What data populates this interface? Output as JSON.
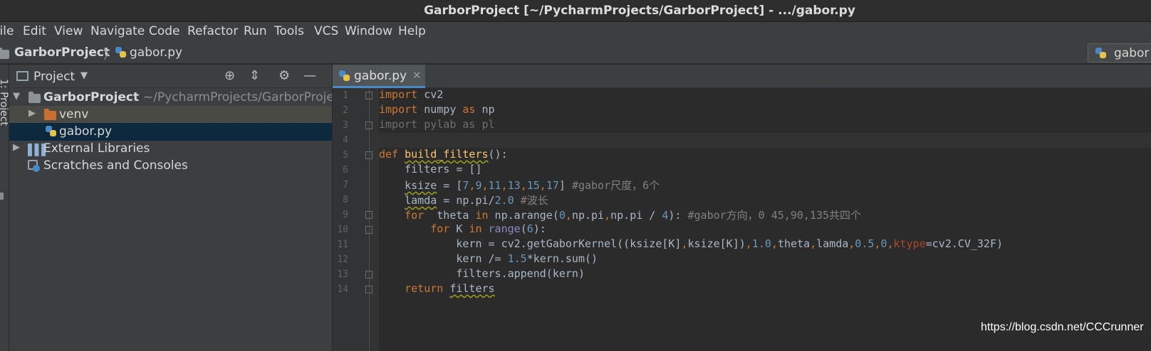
{
  "window": {
    "title": "GarborProject [~/PycharmProjects/GarborProject] - .../gabor.py"
  },
  "menu": [
    "File",
    "Edit",
    "View",
    "Navigate",
    "Code",
    "Refactor",
    "Run",
    "Tools",
    "VCS",
    "Window",
    "Help"
  ],
  "breadcrumb": {
    "project": "GarborProject",
    "file": "gabor.py"
  },
  "run_config": {
    "label": "gabor"
  },
  "tool_strip": {
    "label": "1: Project"
  },
  "project_panel": {
    "title": "Project",
    "tree": [
      {
        "label": "GarborProject",
        "path": "~/PycharmProjects/GarborProject"
      },
      {
        "label": "venv"
      },
      {
        "label": "gabor.py"
      },
      {
        "label": "External Libraries"
      },
      {
        "label": "Scratches and Consoles"
      }
    ]
  },
  "editor": {
    "tab": {
      "label": "gabor.py"
    },
    "line_numbers": [
      "1",
      "2",
      "3",
      "4",
      "5",
      "6",
      "7",
      "8",
      "9",
      "10",
      "11",
      "12",
      "13",
      "14"
    ]
  },
  "code_lines": [
    {
      "tokens": [
        {
          "c": "kw",
          "t": "import"
        },
        {
          "c": "",
          "t": " cv2"
        }
      ]
    },
    {
      "tokens": [
        {
          "c": "kw",
          "t": "import"
        },
        {
          "c": "",
          "t": " numpy "
        },
        {
          "c": "kw",
          "t": "as"
        },
        {
          "c": "",
          "t": " np"
        }
      ]
    },
    {
      "tokens": [
        {
          "c": "dim",
          "t": "import pylab as pl"
        }
      ]
    },
    {
      "tokens": []
    },
    {
      "tokens": [
        {
          "c": "kw",
          "t": "def "
        },
        {
          "c": "fn wavy",
          "t": "build_filters"
        },
        {
          "c": "",
          "t": "():"
        }
      ]
    },
    {
      "tokens": [
        {
          "c": "",
          "t": "    filters = []"
        }
      ]
    },
    {
      "tokens": [
        {
          "c": "",
          "t": "    "
        },
        {
          "c": "wavy",
          "t": "ksize"
        },
        {
          "c": "",
          "t": " = ["
        },
        {
          "c": "num",
          "t": "7"
        },
        {
          "c": "kw",
          "t": ","
        },
        {
          "c": "num",
          "t": "9"
        },
        {
          "c": "kw",
          "t": ","
        },
        {
          "c": "num",
          "t": "11"
        },
        {
          "c": "kw",
          "t": ","
        },
        {
          "c": "num",
          "t": "13"
        },
        {
          "c": "kw",
          "t": ","
        },
        {
          "c": "num",
          "t": "15"
        },
        {
          "c": "kw",
          "t": ","
        },
        {
          "c": "num",
          "t": "17"
        },
        {
          "c": "",
          "t": "] "
        },
        {
          "c": "cm",
          "t": "#gabor尺度，6个"
        }
      ]
    },
    {
      "tokens": [
        {
          "c": "",
          "t": "    "
        },
        {
          "c": "wavy",
          "t": "lamda"
        },
        {
          "c": "",
          "t": " = np.pi/"
        },
        {
          "c": "num",
          "t": "2.0"
        },
        {
          "c": "",
          "t": " "
        },
        {
          "c": "cm",
          "t": "#波长"
        }
      ]
    },
    {
      "tokens": [
        {
          "c": "",
          "t": "    "
        },
        {
          "c": "kw",
          "t": "for"
        },
        {
          "c": "",
          "t": "  theta "
        },
        {
          "c": "kw",
          "t": "in"
        },
        {
          "c": "",
          "t": " np.arange("
        },
        {
          "c": "num",
          "t": "0"
        },
        {
          "c": "kw",
          "t": ","
        },
        {
          "c": "",
          "t": "np.pi"
        },
        {
          "c": "kw",
          "t": ","
        },
        {
          "c": "",
          "t": "np.pi / "
        },
        {
          "c": "num",
          "t": "4"
        },
        {
          "c": "",
          "t": "): "
        },
        {
          "c": "cm",
          "t": "#gabor方向，0 45,90,135共四个"
        }
      ]
    },
    {
      "tokens": [
        {
          "c": "",
          "t": "        "
        },
        {
          "c": "kw",
          "t": "for"
        },
        {
          "c": "",
          "t": " K "
        },
        {
          "c": "kw",
          "t": "in"
        },
        {
          "c": "",
          "t": " "
        },
        {
          "c": "bi",
          "t": "range"
        },
        {
          "c": "",
          "t": "("
        },
        {
          "c": "num",
          "t": "6"
        },
        {
          "c": "",
          "t": "):"
        }
      ]
    },
    {
      "tokens": [
        {
          "c": "",
          "t": "            kern = cv2.getGaborKernel((ksize[K]"
        },
        {
          "c": "kw",
          "t": ","
        },
        {
          "c": "",
          "t": "ksize[K])"
        },
        {
          "c": "kw",
          "t": ","
        },
        {
          "c": "num",
          "t": "1.0"
        },
        {
          "c": "kw",
          "t": ","
        },
        {
          "c": "",
          "t": "theta"
        },
        {
          "c": "kw",
          "t": ","
        },
        {
          "c": "",
          "t": "lamda"
        },
        {
          "c": "kw",
          "t": ","
        },
        {
          "c": "num",
          "t": "0.5"
        },
        {
          "c": "kw",
          "t": ","
        },
        {
          "c": "num",
          "t": "0"
        },
        {
          "c": "kw",
          "t": ","
        },
        {
          "c": "pa",
          "t": "ktype"
        },
        {
          "c": "",
          "t": "=cv2.CV_32F)"
        }
      ]
    },
    {
      "tokens": [
        {
          "c": "",
          "t": "            kern /= "
        },
        {
          "c": "num",
          "t": "1.5"
        },
        {
          "c": "",
          "t": "*kern.sum()"
        }
      ]
    },
    {
      "tokens": [
        {
          "c": "",
          "t": "            filters.append(kern)"
        }
      ]
    },
    {
      "tokens": [
        {
          "c": "",
          "t": "    "
        },
        {
          "c": "kw",
          "t": "return"
        },
        {
          "c": "",
          "t": " "
        },
        {
          "c": "wavy",
          "t": "filters"
        }
      ]
    }
  ],
  "watermark": "https://blog.csdn.net/CCCrunner",
  "colors": {
    "keyword": "#cc7832",
    "function": "#ffc66d",
    "number": "#6897bb",
    "comment": "#808080",
    "tab_accent": "#4a88c7",
    "folder": "#c96f30"
  }
}
